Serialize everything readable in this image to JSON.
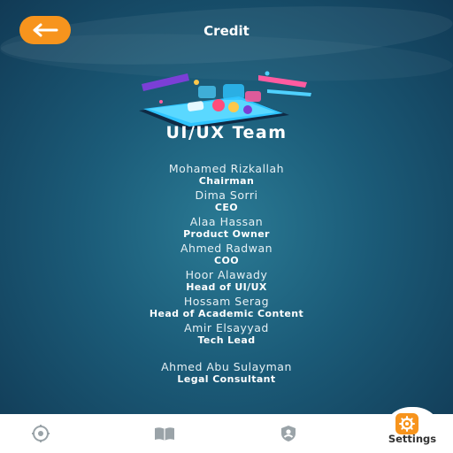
{
  "header": {
    "title": "Credit",
    "back_icon": "arrow-left-icon"
  },
  "team_title": "UI/UX Team",
  "credits": [
    {
      "name": "Mohamed Rizkallah",
      "role": "Chairman"
    },
    {
      "name": "Dima Sorri",
      "role": "CEO"
    },
    {
      "name": "Alaa Hassan",
      "role": "Product Owner"
    },
    {
      "name": "Ahmed Radwan",
      "role": "COO"
    },
    {
      "name": "Hoor Alawady",
      "role": "Head of UI/UX"
    },
    {
      "name": "Hossam Serag",
      "role": "Head of Academic Content"
    },
    {
      "name": "Amir Elsayyad",
      "role": "Tech Lead"
    },
    {
      "name": "Ahmed Abu Sulayman",
      "role": "Legal Consultant"
    }
  ],
  "bottom_nav": {
    "items": [
      {
        "icon": "compass-icon",
        "label": ""
      },
      {
        "icon": "book-icon",
        "label": ""
      },
      {
        "icon": "user-shield-icon",
        "label": ""
      },
      {
        "icon": "gear-icon",
        "label": "Settings",
        "active": true
      }
    ]
  },
  "colors": {
    "accent": "#f7941d",
    "background_dark": "#113a55",
    "background_mid": "#2a7a94",
    "nav_icon": "#9aa3a8"
  }
}
